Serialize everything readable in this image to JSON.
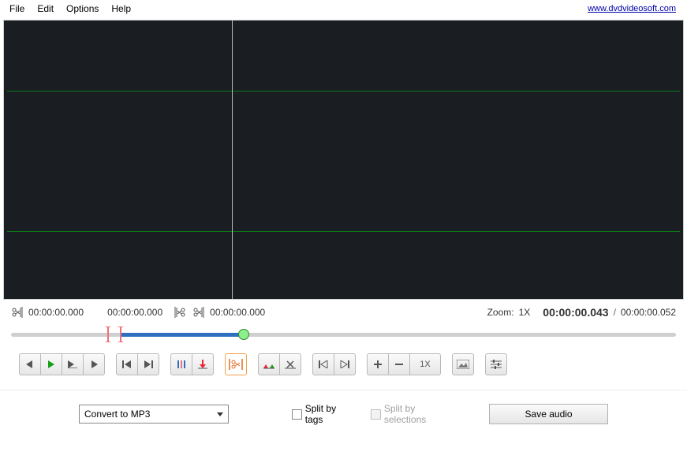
{
  "menu": {
    "file": "File",
    "edit": "Edit",
    "options": "Options",
    "help": "Help"
  },
  "header_link": "www.dvdvideosoft.com",
  "times": {
    "sel_start": "00:00:00.000",
    "sel_mid": "00:00:00.000",
    "sel_end": "00:00:00.000",
    "zoom_label": "Zoom:",
    "zoom_value": "1X",
    "current": "00:00:00.043",
    "total": "00:00:00.052"
  },
  "buttons": {
    "zoom_level": "1X"
  },
  "dropdown": {
    "selected": "Convert to MP3"
  },
  "checkboxes": {
    "split_tags": "Split by tags",
    "split_sel": "Split by selections"
  },
  "save_label": "Save audio"
}
